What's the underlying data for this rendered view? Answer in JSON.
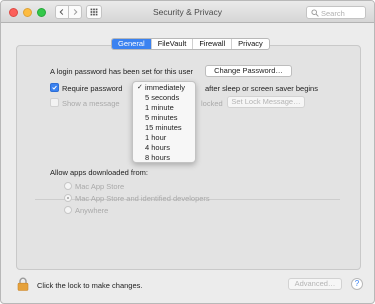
{
  "window": {
    "title": "Security & Privacy",
    "search_placeholder": "Search"
  },
  "tabs": [
    {
      "label": "General",
      "active": true
    },
    {
      "label": "FileVault",
      "active": false
    },
    {
      "label": "Firewall",
      "active": false
    },
    {
      "label": "Privacy",
      "active": false
    }
  ],
  "general": {
    "password_set_label": "A login password has been set for this user",
    "change_password_button": "Change Password…",
    "require_password_label": "Require password",
    "require_password_checked": true,
    "require_password_suffix": "after sleep or screen saver begins",
    "show_message_label": "Show a message",
    "show_message_suffix": "locked",
    "set_lock_message_button": "Set Lock Message…",
    "allow_apps_label": "Allow apps downloaded from:",
    "app_sources": [
      {
        "label": "Mac App Store",
        "selected": false
      },
      {
        "label": "Mac App Store and identified developers",
        "selected": true
      },
      {
        "label": "Anywhere",
        "selected": false
      }
    ]
  },
  "password_delay_menu": {
    "selected": "immediately",
    "options": [
      "immediately",
      "5 seconds",
      "1 minute",
      "5 minutes",
      "15 minutes",
      "1 hour",
      "4 hours",
      "8 hours"
    ],
    "check_glyph": "✓"
  },
  "footer": {
    "lock_label": "Click the lock to make changes.",
    "advanced_button": "Advanced…",
    "help_glyph": "?"
  },
  "colors": {
    "accent": "#3b82f0",
    "lock": "#e6a23c"
  }
}
